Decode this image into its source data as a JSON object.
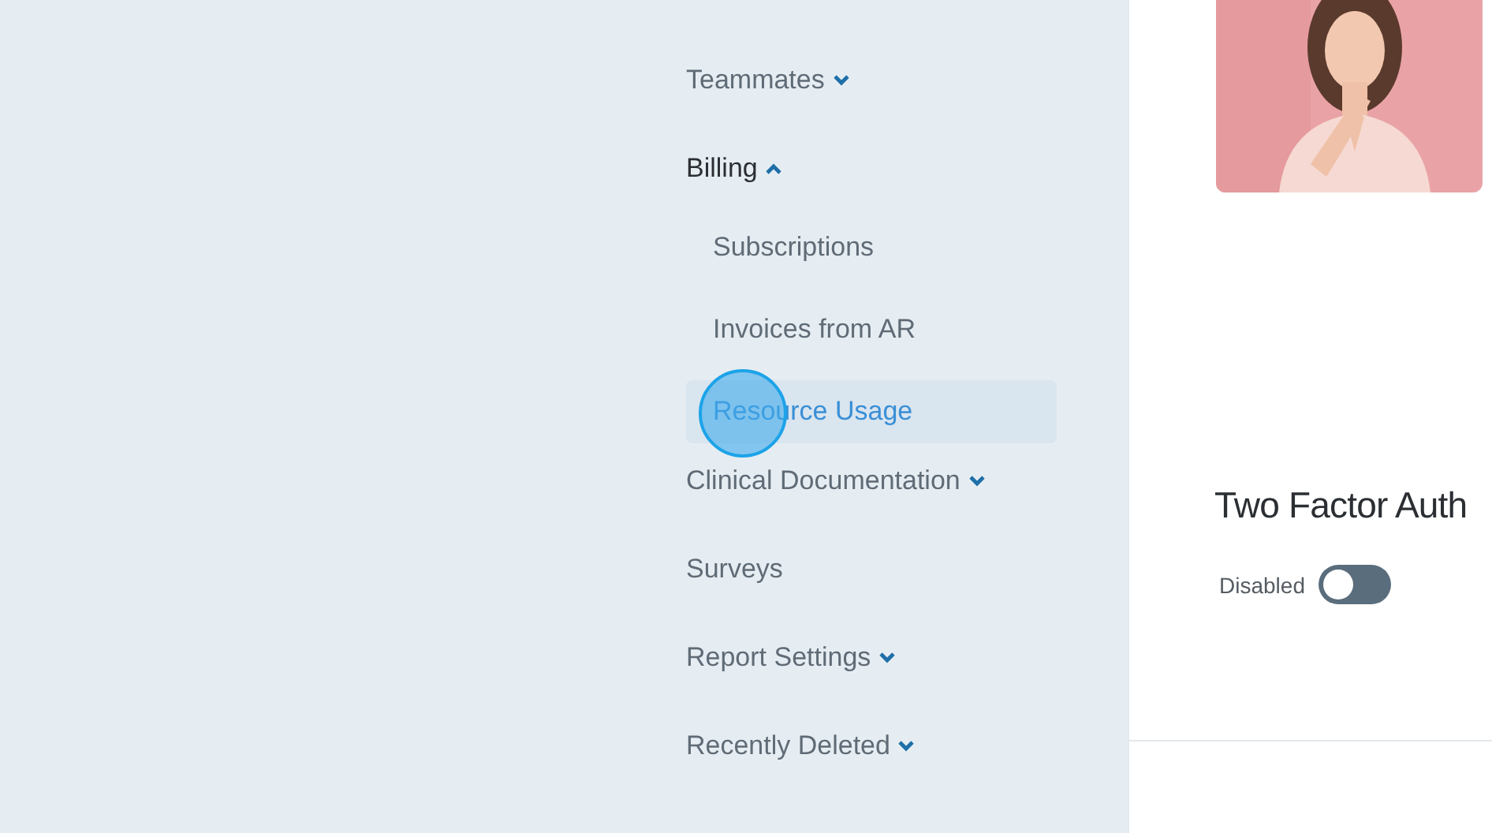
{
  "sidebar": {
    "items": [
      {
        "label": "Teammates",
        "kind": "group",
        "expanded": false
      },
      {
        "label": "Billing",
        "kind": "group",
        "expanded": true,
        "children": [
          {
            "label": "Subscriptions",
            "selected": false
          },
          {
            "label": "Invoices from AR",
            "selected": false
          },
          {
            "label": "Resource Usage",
            "selected": true
          }
        ]
      },
      {
        "label": "Clinical Documentation",
        "kind": "group",
        "expanded": false
      },
      {
        "label": "Surveys",
        "kind": "link"
      },
      {
        "label": "Report Settings",
        "kind": "group",
        "expanded": false
      },
      {
        "label": "Recently Deleted",
        "kind": "group",
        "expanded": false
      }
    ]
  },
  "two_factor": {
    "title": "Two Factor Auth",
    "status": "Disabled",
    "on": false
  }
}
